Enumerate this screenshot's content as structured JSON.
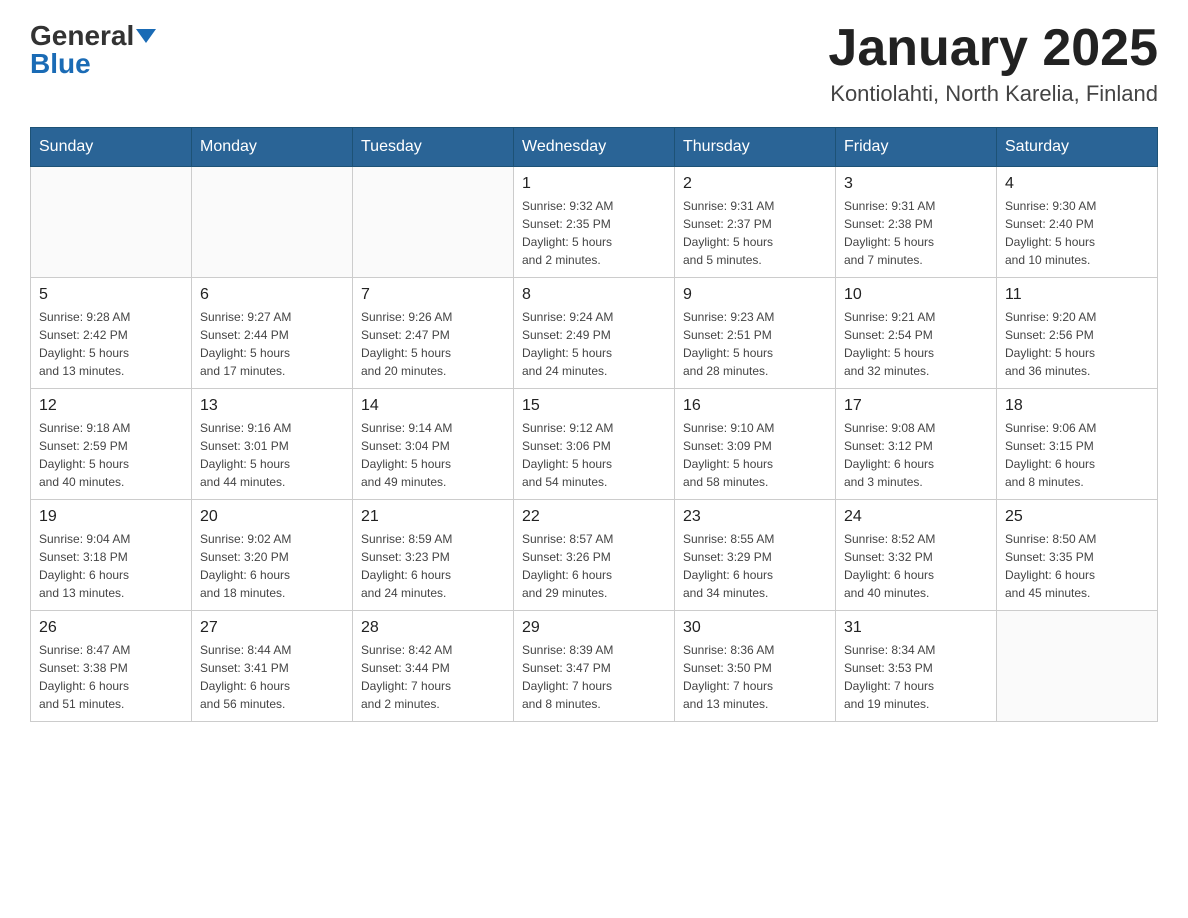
{
  "logo": {
    "text_general": "General",
    "text_blue": "Blue"
  },
  "header": {
    "title": "January 2025",
    "subtitle": "Kontiolahti, North Karelia, Finland"
  },
  "weekdays": [
    "Sunday",
    "Monday",
    "Tuesday",
    "Wednesday",
    "Thursday",
    "Friday",
    "Saturday"
  ],
  "weeks": [
    [
      {
        "day": "",
        "info": ""
      },
      {
        "day": "",
        "info": ""
      },
      {
        "day": "",
        "info": ""
      },
      {
        "day": "1",
        "info": "Sunrise: 9:32 AM\nSunset: 2:35 PM\nDaylight: 5 hours\nand 2 minutes."
      },
      {
        "day": "2",
        "info": "Sunrise: 9:31 AM\nSunset: 2:37 PM\nDaylight: 5 hours\nand 5 minutes."
      },
      {
        "day": "3",
        "info": "Sunrise: 9:31 AM\nSunset: 2:38 PM\nDaylight: 5 hours\nand 7 minutes."
      },
      {
        "day": "4",
        "info": "Sunrise: 9:30 AM\nSunset: 2:40 PM\nDaylight: 5 hours\nand 10 minutes."
      }
    ],
    [
      {
        "day": "5",
        "info": "Sunrise: 9:28 AM\nSunset: 2:42 PM\nDaylight: 5 hours\nand 13 minutes."
      },
      {
        "day": "6",
        "info": "Sunrise: 9:27 AM\nSunset: 2:44 PM\nDaylight: 5 hours\nand 17 minutes."
      },
      {
        "day": "7",
        "info": "Sunrise: 9:26 AM\nSunset: 2:47 PM\nDaylight: 5 hours\nand 20 minutes."
      },
      {
        "day": "8",
        "info": "Sunrise: 9:24 AM\nSunset: 2:49 PM\nDaylight: 5 hours\nand 24 minutes."
      },
      {
        "day": "9",
        "info": "Sunrise: 9:23 AM\nSunset: 2:51 PM\nDaylight: 5 hours\nand 28 minutes."
      },
      {
        "day": "10",
        "info": "Sunrise: 9:21 AM\nSunset: 2:54 PM\nDaylight: 5 hours\nand 32 minutes."
      },
      {
        "day": "11",
        "info": "Sunrise: 9:20 AM\nSunset: 2:56 PM\nDaylight: 5 hours\nand 36 minutes."
      }
    ],
    [
      {
        "day": "12",
        "info": "Sunrise: 9:18 AM\nSunset: 2:59 PM\nDaylight: 5 hours\nand 40 minutes."
      },
      {
        "day": "13",
        "info": "Sunrise: 9:16 AM\nSunset: 3:01 PM\nDaylight: 5 hours\nand 44 minutes."
      },
      {
        "day": "14",
        "info": "Sunrise: 9:14 AM\nSunset: 3:04 PM\nDaylight: 5 hours\nand 49 minutes."
      },
      {
        "day": "15",
        "info": "Sunrise: 9:12 AM\nSunset: 3:06 PM\nDaylight: 5 hours\nand 54 minutes."
      },
      {
        "day": "16",
        "info": "Sunrise: 9:10 AM\nSunset: 3:09 PM\nDaylight: 5 hours\nand 58 minutes."
      },
      {
        "day": "17",
        "info": "Sunrise: 9:08 AM\nSunset: 3:12 PM\nDaylight: 6 hours\nand 3 minutes."
      },
      {
        "day": "18",
        "info": "Sunrise: 9:06 AM\nSunset: 3:15 PM\nDaylight: 6 hours\nand 8 minutes."
      }
    ],
    [
      {
        "day": "19",
        "info": "Sunrise: 9:04 AM\nSunset: 3:18 PM\nDaylight: 6 hours\nand 13 minutes."
      },
      {
        "day": "20",
        "info": "Sunrise: 9:02 AM\nSunset: 3:20 PM\nDaylight: 6 hours\nand 18 minutes."
      },
      {
        "day": "21",
        "info": "Sunrise: 8:59 AM\nSunset: 3:23 PM\nDaylight: 6 hours\nand 24 minutes."
      },
      {
        "day": "22",
        "info": "Sunrise: 8:57 AM\nSunset: 3:26 PM\nDaylight: 6 hours\nand 29 minutes."
      },
      {
        "day": "23",
        "info": "Sunrise: 8:55 AM\nSunset: 3:29 PM\nDaylight: 6 hours\nand 34 minutes."
      },
      {
        "day": "24",
        "info": "Sunrise: 8:52 AM\nSunset: 3:32 PM\nDaylight: 6 hours\nand 40 minutes."
      },
      {
        "day": "25",
        "info": "Sunrise: 8:50 AM\nSunset: 3:35 PM\nDaylight: 6 hours\nand 45 minutes."
      }
    ],
    [
      {
        "day": "26",
        "info": "Sunrise: 8:47 AM\nSunset: 3:38 PM\nDaylight: 6 hours\nand 51 minutes."
      },
      {
        "day": "27",
        "info": "Sunrise: 8:44 AM\nSunset: 3:41 PM\nDaylight: 6 hours\nand 56 minutes."
      },
      {
        "day": "28",
        "info": "Sunrise: 8:42 AM\nSunset: 3:44 PM\nDaylight: 7 hours\nand 2 minutes."
      },
      {
        "day": "29",
        "info": "Sunrise: 8:39 AM\nSunset: 3:47 PM\nDaylight: 7 hours\nand 8 minutes."
      },
      {
        "day": "30",
        "info": "Sunrise: 8:36 AM\nSunset: 3:50 PM\nDaylight: 7 hours\nand 13 minutes."
      },
      {
        "day": "31",
        "info": "Sunrise: 8:34 AM\nSunset: 3:53 PM\nDaylight: 7 hours\nand 19 minutes."
      },
      {
        "day": "",
        "info": ""
      }
    ]
  ],
  "colors": {
    "header_bg": "#2a6496",
    "header_text": "#ffffff",
    "border": "#ccc",
    "row_border_top": "#4a90d9"
  }
}
